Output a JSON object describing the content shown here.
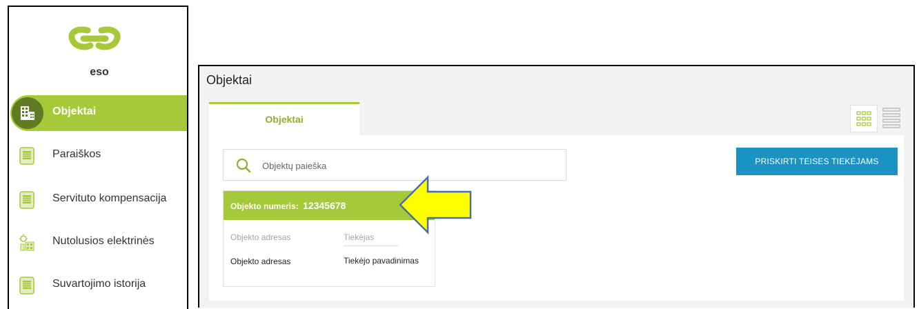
{
  "sidebar": {
    "logo_text": "eso",
    "items": [
      {
        "label": "Objektai",
        "active": true
      },
      {
        "label": "Paraiškos",
        "active": false
      },
      {
        "label": "Servituto kompensacija",
        "active": false
      },
      {
        "label": "Nutolusios elektrinės",
        "active": false
      },
      {
        "label": "Suvartojimo istorija",
        "active": false
      }
    ]
  },
  "main": {
    "title": "Objektai",
    "tabs": [
      {
        "label": "Objektai"
      }
    ],
    "search": {
      "placeholder": "Objektų paieška",
      "value": ""
    },
    "assign_button": "PRISKIRTI TEISES TIEKĖJAMS",
    "card": {
      "number_label": "Objekto numeris:",
      "number_value": "12345678",
      "address_label": "Objekto adresas",
      "address_value": "Objekto adresas",
      "supplier_label": "Tiekėjas",
      "supplier_value": "Tiekėjo pavadinimas"
    }
  },
  "colors": {
    "brand_green": "#a6c93a",
    "brand_dark_green": "#5f7c25",
    "button_blue": "#1a93c2",
    "annotation_arrow": "#ffff00"
  },
  "icons": {
    "logo": "eso-logo-icon",
    "objects": "building-icon",
    "applications": "document-icon",
    "compensation": "document-icon",
    "remote_plants": "solar-plant-icon",
    "history": "document-icon",
    "search": "search-icon",
    "grid_view": "grid-view-icon",
    "list_view": "list-view-icon"
  }
}
